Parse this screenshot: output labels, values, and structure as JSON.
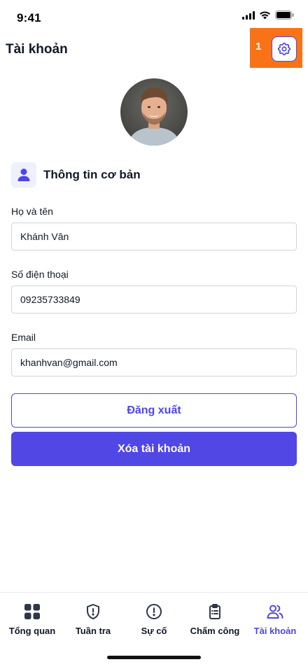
{
  "status_bar": {
    "time": "9:41"
  },
  "header": {
    "title": "Tài khoản",
    "annotation_number": "1"
  },
  "profile": {
    "section_title": "Thông tin cơ bản",
    "fields": [
      {
        "label": "Họ và tên",
        "value": "Khánh Vân"
      },
      {
        "label": "Số điện thoại",
        "value": "09235733849"
      },
      {
        "label": "Email",
        "value": "khanhvan@gmail.com"
      }
    ]
  },
  "actions": {
    "logout_label": "Đăng xuất",
    "delete_label": "Xóa tài khoản"
  },
  "bottom_nav": {
    "active_index": 4,
    "items": [
      {
        "label": "Tổng quan",
        "icon": "grid-icon"
      },
      {
        "label": "Tuần tra",
        "icon": "shield-icon"
      },
      {
        "label": "Sự cố",
        "icon": "alert-circle-icon"
      },
      {
        "label": "Chấm công",
        "icon": "clipboard-icon"
      },
      {
        "label": "Tài khoản",
        "icon": "users-icon"
      }
    ]
  },
  "colors": {
    "accent": "#4f46e5",
    "annotation": "#f97316",
    "text": "#111827",
    "border": "#d1d5db"
  }
}
